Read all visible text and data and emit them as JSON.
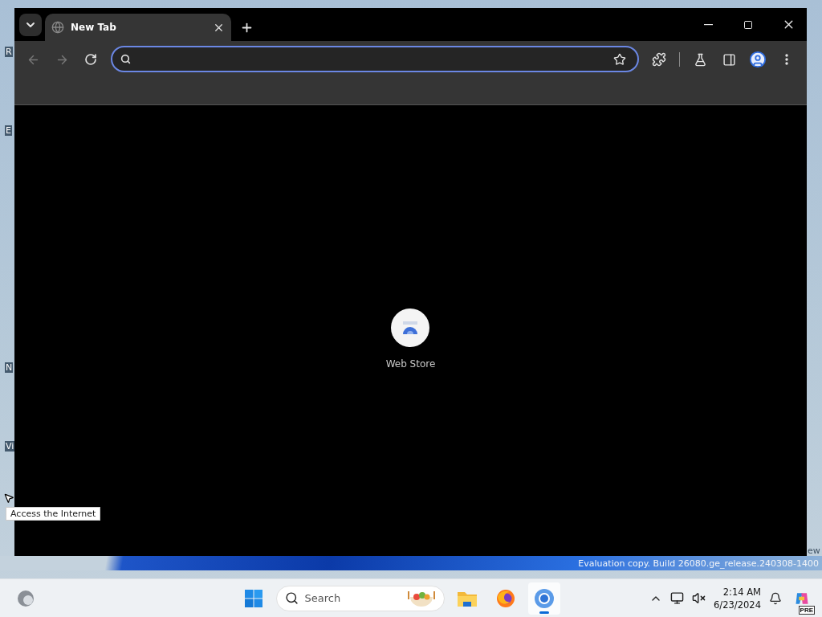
{
  "desktop": {
    "icon_labels": [
      "R",
      "E",
      "N",
      "Vi"
    ],
    "tooltip": "Access the Internet",
    "corner_text": "ew",
    "watermark": "Evaluation copy. Build 26080.ge_release.240308-1400"
  },
  "browser": {
    "tabs": [
      {
        "title": "New Tab",
        "selected": true
      }
    ],
    "shortcuts": [
      {
        "label": "Web Store"
      }
    ]
  },
  "taskbar": {
    "search": {
      "placeholder": "Search"
    },
    "apps": [
      {
        "kind": "files",
        "selected": false
      },
      {
        "kind": "firefox",
        "selected": false
      },
      {
        "kind": "chrome",
        "selected": true
      }
    ],
    "time": "2:14 AM",
    "date": "6/23/2024",
    "copilot_badge": "PRE"
  }
}
